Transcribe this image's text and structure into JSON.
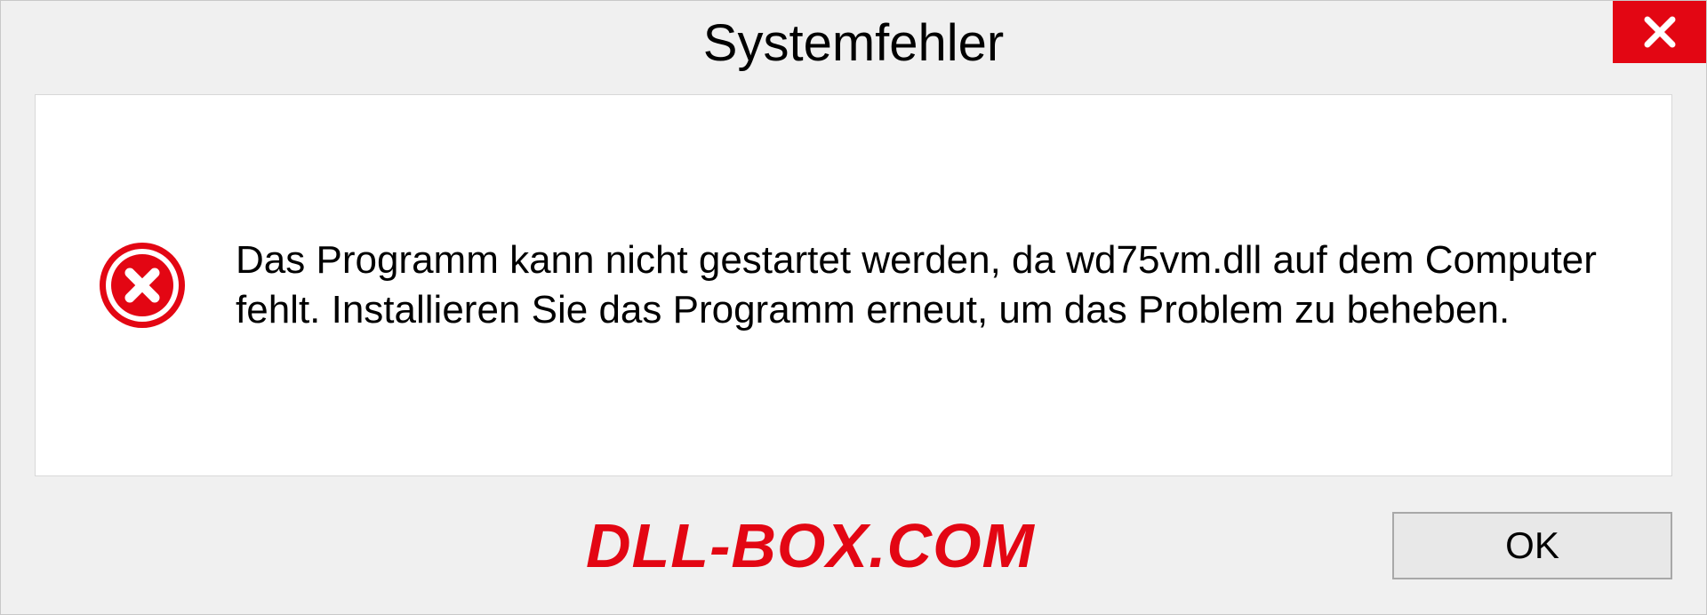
{
  "dialog": {
    "title": "Systemfehler",
    "message": "Das Programm kann nicht gestartet werden, da wd75vm.dll auf dem Computer fehlt. Installieren Sie das Programm erneut, um das Problem zu beheben.",
    "ok_label": "OK"
  },
  "watermark": "DLL-BOX.COM"
}
